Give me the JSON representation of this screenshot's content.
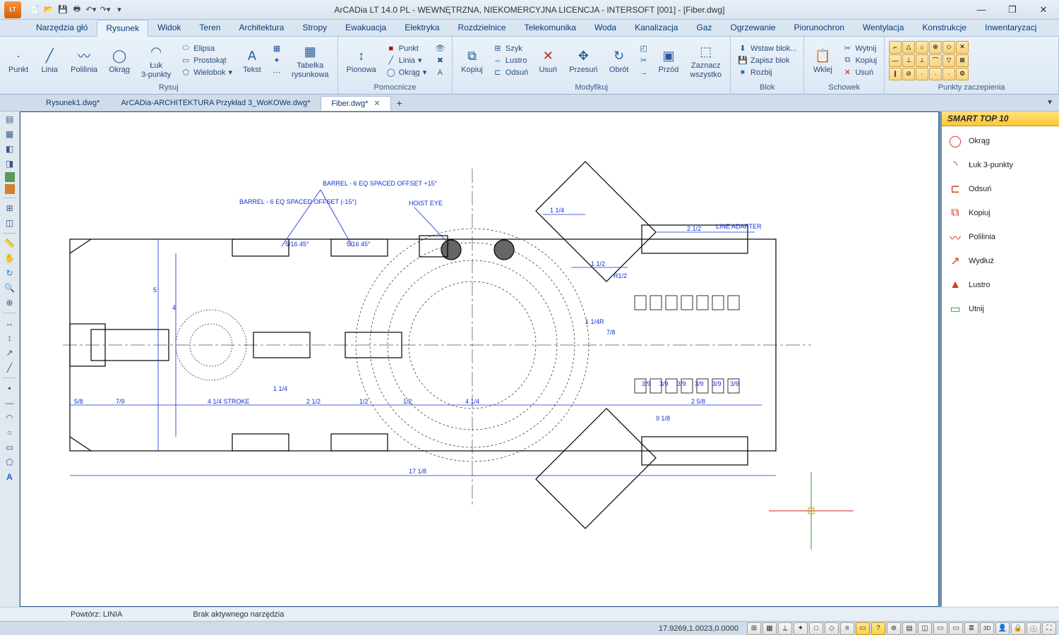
{
  "title": "ArCADia LT 14.0 PL - WEWNĘTRZNA, NIEKOMERCYJNA LICENCJA - INTERSOFT [001] - [Fiber.dwg]",
  "app_badge": "LT",
  "tabs": {
    "t0": "Narzędzia głó",
    "t1": "Rysunek",
    "t2": "Widok",
    "t3": "Teren",
    "t4": "Architektura",
    "t5": "Stropy",
    "t6": "Ewakuacja",
    "t7": "Elektryka",
    "t8": "Rozdzielnice",
    "t9": "Telekomunika",
    "t10": "Woda",
    "t11": "Kanalizacja",
    "t12": "Gaz",
    "t13": "Ogrzewanie",
    "t14": "Piorunochron",
    "t15": "Wentylacja",
    "t16": "Konstrukcje",
    "t17": "Inwentaryzacj"
  },
  "ribbon": {
    "g1": "Rysuj",
    "g2": "Pomocnicze",
    "g3": "Modyfikuj",
    "g4": "Blok",
    "g5": "Schowek",
    "g6": "Punkty zaczepienia",
    "punkt": "Punkt",
    "linia": "Linia",
    "polilinia": "Polilinia",
    "okrag": "Okrąg",
    "luk": "Łuk\n3-punkty",
    "elipsa": "Elipsa",
    "prostokat": "Prostokąt",
    "wielobok": "Wielobok",
    "tekst": "Tekst",
    "tabelka": "Tabelka\nrysunkowa",
    "pionowa": "Pionowa",
    "p_punkt": "Punkt",
    "p_linia": "Linia",
    "p_okrag": "Okrąg",
    "kopiuj": "Kopiuj",
    "szyk": "Szyk",
    "lustro": "Lustro",
    "odsun": "Odsuń",
    "usun": "Usuń",
    "przesun": "Przesuń",
    "obrot": "Obrót",
    "przod": "Przód",
    "zaznacz": "Zaznacz\nwszystko",
    "wstawblok": "Wstaw blok...",
    "zapiszblok": "Zapisz blok",
    "rozbij": "Rozbij",
    "wklej": "Wklej",
    "wytnij": "Wytnij",
    "s_kopiuj": "Kopiuj",
    "s_usun": "Usuń"
  },
  "doctabs": {
    "d0": "Rysunek1.dwg*",
    "d1": "ArCADia-ARCHITEKTURA Przykład 3_WoKOWe.dwg*",
    "d2": "Fiber.dwg*"
  },
  "smart": {
    "title": "SMART TOP 10",
    "i0": "Okrąg",
    "i1": "Łuk 3-punkty",
    "i2": "Odsuń",
    "i3": "Kopiuj",
    "i4": "Polilinia",
    "i5": "Wydłuż",
    "i6": "Lustro",
    "i7": "Utnij"
  },
  "status": {
    "repeat": "Powtórz: LINIA",
    "msg": "Brak aktywnego narzędzia",
    "coords": "17.9269,1.0023,0.0000"
  },
  "drawing": {
    "labels": {
      "barrel1": "BARREL - 6 EQ SPACED\nOFFSET +15°",
      "barrel2": "BARREL - 6 EQ SPACED\nOFFSET (-15°)",
      "hoisteye": "HOIST EYE",
      "lineadapter": "LINE\nADAPTER",
      "r12": "R1/2",
      "dim114r": "1 1/4R",
      "dim78": "7/8",
      "dim112": "1 1/2",
      "dim114": "1 1/4",
      "dim212": "2 1/2",
      "dim258": "2 5/8",
      "dim918": "9 1/8",
      "dim1718": "17 1/8",
      "dim58": "5/8",
      "dim79": "7/9",
      "stroke": "4 1/4 STROKE",
      "dim114b": "1 1/4",
      "dim212b": "2 1/2",
      "dim12": "1/2",
      "dim12b": "1/2",
      "dim414": "4 1/4",
      "dim516a": "5/16\n45°",
      "dim516b": "5/16\n45°",
      "dim39": "3/9",
      "dim5": "5",
      "dim4": "4"
    }
  }
}
